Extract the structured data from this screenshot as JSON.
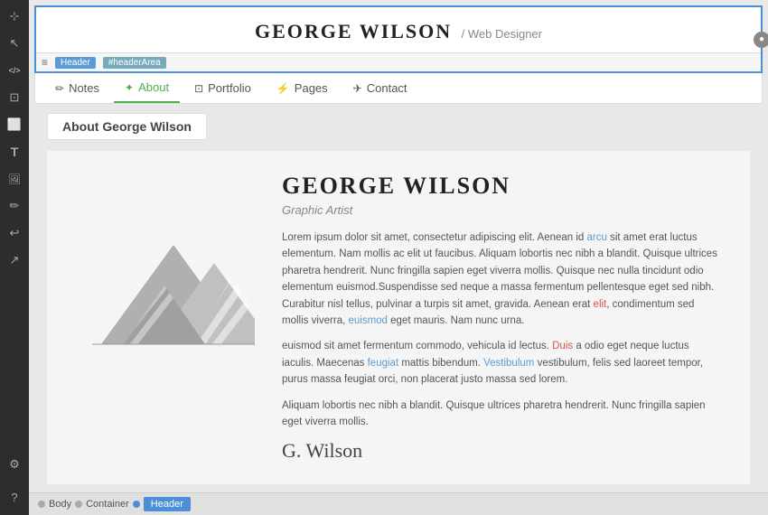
{
  "sidebar": {
    "icons": [
      {
        "name": "pointer-icon",
        "symbol": "⊹",
        "active": false
      },
      {
        "name": "cursor-icon",
        "symbol": "↖",
        "active": false
      },
      {
        "name": "code-icon",
        "symbol": "</>",
        "active": false
      },
      {
        "name": "page-icon",
        "symbol": "⊡",
        "active": false
      },
      {
        "name": "box-icon",
        "symbol": "⬜",
        "active": false
      },
      {
        "name": "text-icon",
        "symbol": "T",
        "active": false
      },
      {
        "name": "image-icon",
        "symbol": "🖼",
        "active": false
      },
      {
        "name": "draw-icon",
        "symbol": "✏",
        "active": false
      },
      {
        "name": "undo-icon",
        "symbol": "↩",
        "active": false
      },
      {
        "name": "share-icon",
        "symbol": "↗",
        "active": false
      }
    ]
  },
  "header": {
    "site_name": "GEORGE WILSON",
    "site_role": "/ Web Designer",
    "toolbar_icon": "≡",
    "toolbar_tag1": "Header",
    "toolbar_tag2": "#headerArea"
  },
  "nav": {
    "items": [
      {
        "label": "Notes",
        "icon": "✏",
        "active": false
      },
      {
        "label": "About",
        "icon": "✦",
        "active": true
      },
      {
        "label": "Portfolio",
        "icon": "⊡",
        "active": false
      },
      {
        "label": "Pages",
        "icon": "⚡",
        "active": false
      },
      {
        "label": "Contact",
        "icon": "✈",
        "active": false
      }
    ]
  },
  "about_section": {
    "label": "About George Wilson",
    "person_name": "GEORGE WILSON",
    "person_title": "Graphic Artist",
    "paragraphs": [
      "Lorem ipsum dolor sit amet, consectetur adipiscing elit. Aenean id arcu sit amet erat luctus elementum. Nam mollis ac elit ut faucibus. Aliquam lobortis nec nibh a blandit. Quisque ultrices pharetra hendrerit. Nunc fringilla sapien eget viverra mollis. Quisque nec nulla tincidunt odio elementum euismod.Suspendisse sed neque a massa fermentum pellentesque eget sed nibh. Curabitur nisl tellus, pulvinar a turpis sit amet, gravida. Aenean erat elit, condimentum sed mollis viverra, euismod eget mauris. Nam nunc urna.",
      "euismod sit amet fermentum commodo, vehicula id lectus. Duis a odio eget neque luctus iaculis. Maecenas feugiat mattis bibendum. Vestibulum vestibulum, felis sed laoreet tempor, purus massa feugiat orci, non placerat justo massa sed lorem.",
      "Aliquam lobortis nec nibh a blandit. Quisque ultrices pharetra hendrerit. Nunc fringilla sapien eget viverra mollis."
    ],
    "signature": "G. Wilson"
  },
  "status_bar": {
    "items": [
      {
        "label": "Body",
        "active": false
      },
      {
        "label": "Container",
        "active": false
      },
      {
        "label": "Header",
        "active": true
      }
    ]
  }
}
